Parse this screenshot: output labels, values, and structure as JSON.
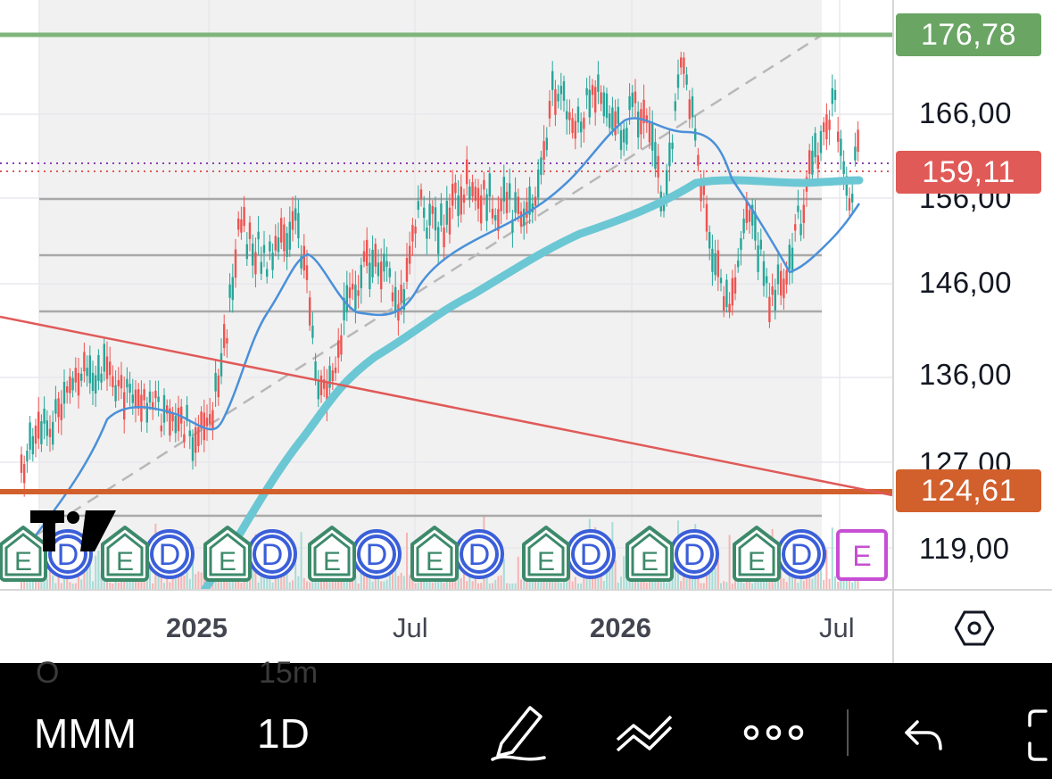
{
  "symbol": "MMM",
  "interval": "1D",
  "price_axis": {
    "ticks": [
      "166,00",
      "156,00",
      "146,00",
      "136,00",
      "127,00",
      "119,00"
    ],
    "badges": {
      "high": {
        "value": "176,78",
        "color": "#6aa564"
      },
      "last": {
        "value": "159,11",
        "color": "#e05a57"
      },
      "low": {
        "value": "124,61",
        "color": "#d2602d"
      }
    }
  },
  "time_axis": {
    "labels": [
      {
        "text": "2025",
        "bold": true
      },
      {
        "text": "Jul",
        "bold": false
      },
      {
        "text": "2026",
        "bold": true
      },
      {
        "text": "Jul",
        "bold": false
      }
    ]
  },
  "ghost_labels": [
    "O",
    "15m"
  ],
  "events": [
    {
      "type": "earnings",
      "label": "E"
    },
    {
      "type": "dividend",
      "label": "D"
    },
    {
      "type": "earnings",
      "label": "E"
    },
    {
      "type": "dividend",
      "label": "D"
    },
    {
      "type": "earnings",
      "label": "E"
    },
    {
      "type": "dividend",
      "label": "D"
    },
    {
      "type": "earnings",
      "label": "E"
    },
    {
      "type": "dividend",
      "label": "D"
    },
    {
      "type": "earnings",
      "label": "E"
    },
    {
      "type": "dividend",
      "label": "D"
    },
    {
      "type": "earnings",
      "label": "E"
    },
    {
      "type": "dividend",
      "label": "D"
    },
    {
      "type": "earnings",
      "label": "E"
    },
    {
      "type": "dividend",
      "label": "D"
    },
    {
      "type": "earnings",
      "label": "E"
    },
    {
      "type": "dividend",
      "label": "D"
    },
    {
      "type": "earnings-upcoming",
      "label": "E"
    }
  ],
  "toolbar": {
    "icons": [
      "pen-icon",
      "indicators-icon",
      "more-icon",
      "undo-icon",
      "fullscreen-icon"
    ]
  },
  "colors": {
    "up": "#26a69a",
    "down": "#ef5350",
    "ma_fast": "#4a90d9",
    "ma_slow": "#6cc7d4",
    "earnings": "#3d8a6b",
    "dividend": "#3b5fd9",
    "upcoming": "#c64fd3"
  }
}
